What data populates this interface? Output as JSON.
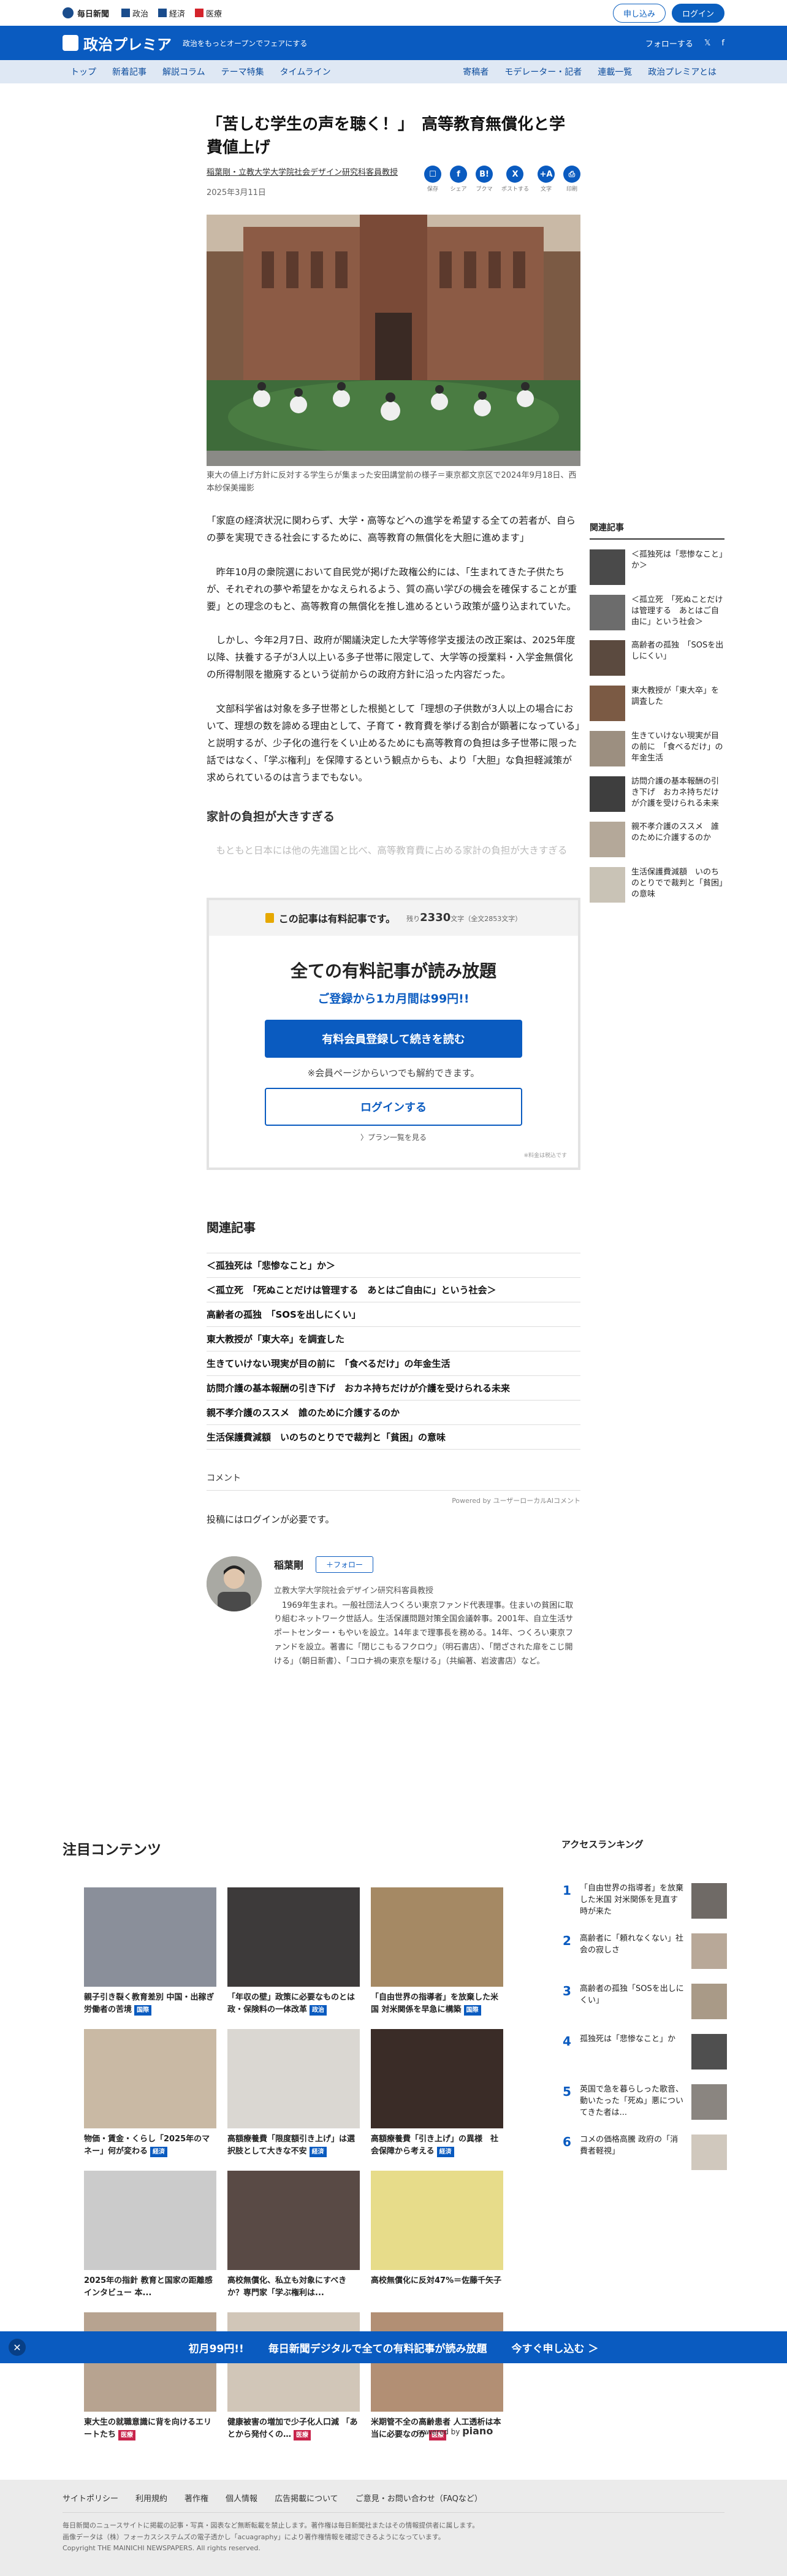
{
  "topbar": {
    "brand": "毎日新聞",
    "sites": [
      "政治",
      "経済",
      "医療"
    ],
    "register": "申し込み",
    "login": "ログイン"
  },
  "header": {
    "logo": "政治プレミア",
    "tagline": "政治をもっとオープンでフェアにする",
    "follow": "フォローする"
  },
  "nav": {
    "left": [
      "トップ",
      "新着記事",
      "解説コラム",
      "テーマ特集",
      "タイムライン"
    ],
    "right": [
      "寄稿者",
      "モデレーター・記者",
      "連載一覧",
      "政治プレミアとは"
    ]
  },
  "article": {
    "title": "「苦しむ学生の声を聴く！」　高等教育無償化と学費値上げ",
    "author_line": "稲葉剛・立教大学大学院社会デザイン研究科客員教授",
    "date": "2025年3月11日",
    "share": [
      {
        "icon": "保存",
        "label": "保存"
      },
      {
        "icon": "f",
        "label": "シェア"
      },
      {
        "icon": "B!",
        "label": "ブクマ"
      },
      {
        "icon": "X",
        "label": "ポストする"
      },
      {
        "icon": "+A",
        "label": "文字"
      },
      {
        "icon": "印",
        "label": "印刷"
      }
    ],
    "caption": "東大の値上げ方針に反対する学生らが集まった安田講堂前の様子＝東京都文京区で2024年9月18日、西本紗保美撮影",
    "paragraphs": [
      "「家庭の経済状況に関わらず、大学・高等などへの進学を希望する全ての若者が、自らの夢を実現できる社会にするために、高等教育の無償化を大胆に進めます」",
      "　昨年10月の衆院選において自民党が掲げた政権公約には、「生まれてきた子供たちが、それぞれの夢や希望をかなえられるよう、質の高い学びの機会を確保することが重要」との理念のもと、高等教育の無償化を推し進めるという政策が盛り込まれていた。",
      "　しかし、今年2月7日、政府が閣議決定した大学等修学支援法の改正案は、2025年度以降、扶養する子が3人以上いる多子世帯に限定して、大学等の授業料・入学金無償化の所得制限を撤廃するという従前からの政府方針に沿った内容だった。",
      "　文部科学省は対象を多子世帯とした根拠として「理想の子供数が3人以上の場合において、理想の数を諦める理由として、子育て・教育費を挙げる割合が顕著になっている」と説明するが、少子化の進行をくい止めるためにも高等教育の負担は多子世帯に限った話ではなく、「学ぶ権利」を保障するという観点からも、より「大胆」な負担軽減策が求められているのは言うまでもない。"
    ],
    "subhead": "家計の負担が大きすぎる",
    "faded": "　もともと日本には他の先進国と比べ、高等教育費に占める家計の負担が大きすぎる"
  },
  "paywall": {
    "notice": "この記事は有料記事です。",
    "remaining_label": "残り",
    "remaining_count": "2330",
    "remaining_unit": "文字（全文2853文字）",
    "title": "全ての有料記事が読み放題",
    "subtitle": "ご登録から1カ月間は99円!!",
    "primary_cta": "有料会員登録して続きを読む",
    "cancel_note": "※会員ページからいつでも解約できます。",
    "login_cta": "ログインする",
    "plans": "〉プラン一覧を見る",
    "version": "※料金は税込です"
  },
  "related": {
    "title": "関連記事",
    "items": [
      "＜孤独死は「悲惨なこと」か＞",
      "＜孤立死　「死ぬことだけは管理する　あとはご自由に」という社会＞",
      "高齢者の孤独　「SOSを出しにくい」",
      "東大教授が「東大卒」を調査した",
      "生きていけない現実が目の前に　「食べるだけ」の年金生活",
      "訪問介護の基本報酬の引き下げ　おカネ持ちだけが介護を受けられる未来",
      "親不孝介護のススメ　誰のために介護するのか",
      "生活保護費減額　いのちのとりでで裁判と「貧困」の意味"
    ]
  },
  "comments": {
    "title": "コメント",
    "powered": "Powered by ユーザーローカルAIコメント",
    "login_note": "投稿にはログインが必要です。"
  },
  "author": {
    "name": "稲葉剛",
    "follow": "＋フォロー",
    "affiliation": "立教大学大学院社会デザイン研究科客員教授",
    "bio": "　1969年生まれ。一般社団法人つくろい東京ファンド代表理事。住まいの貧困に取り組むネットワーク世話人。生活保護問題対策全国会議幹事。2001年、自立生活サポートセンター・もやいを設立。14年まで理事長を務める。14年、つくろい東京ファンドを設立。著書に「閉じこもるフクロウ」（明石書店）、「閉ざされた扉をこじ開ける」（朝日新書）、「コロナ禍の東京を駆ける」（共編著、岩波書店）など。"
  },
  "sidebar": {
    "title": "関連記事",
    "items": [
      "＜孤独死は「悲惨なこと」か＞",
      "＜孤立死　「死ぬことだけは管理する　あとはご自由に」という社会＞",
      "高齢者の孤独　「SOSを出しにくい」",
      "東大教授が「東大卒」を調査した",
      "生きていけない現実が目の前に　「食べるだけ」の年金生活",
      "訪問介護の基本報酬の引き下げ　おカネ持ちだけが介護を受けられる未来",
      "親不孝介護のススメ　誰のために介護するのか",
      "生活保護費減額　いのちのとりでで裁判と「貧困」の意味"
    ]
  },
  "attention": {
    "title": "注目コンテンツ",
    "cards": [
      {
        "title": "親子引き裂く教育差別 中国・出稼ぎ労働者の苦境",
        "tag": "国際",
        "tag_color": "#0a5bc0",
        "color": "#8a8f9a"
      },
      {
        "title": "「年収の壁」政策に必要なものとは 政・保険料の一体改革",
        "tag": "政治",
        "tag_color": "#0a5bc0",
        "color": "#3d3a3a"
      },
      {
        "title": "「自由世界の指導者」を放棄した米国 対米関係を早急に構築",
        "tag": "国際",
        "tag_color": "#0a5bc0",
        "color": "#a58964"
      },
      {
        "title": "物価・賃金・くらし「2025年のマネー」何が変わる",
        "tag": "経済",
        "tag_color": "#0a5bc0",
        "color": "#c9b9a4"
      },
      {
        "title": "高額療養費「限度額引き上げ」は選択肢として大きな不安",
        "tag": "経済",
        "tag_color": "#0a5bc0",
        "color": "#dad7d2"
      },
      {
        "title": "高額療養費「引き上げ」の異様　社会保障から考える",
        "tag": "経済",
        "tag_color": "#0a5bc0",
        "color": "#3a2c27"
      },
      {
        "title": "2025年の指針 教育と国家の距離感 インタビュー 本...",
        "tag": "",
        "tag_color": "#0a5bc0",
        "color": "#cbcbcb"
      },
      {
        "title": "高校無償化、私立も対象にすべきか？専門家「学ぶ権利は...",
        "tag": "",
        "tag_color": "#0a5bc0",
        "color": "#594a45"
      },
      {
        "title": "高校無償化に反対47%＝佐藤千矢子",
        "tag": "",
        "tag_color": "#0a5bc0",
        "color": "#e7dc8a"
      },
      {
        "title": "東大生の就職意識に背を向けるエリートたち",
        "tag": "医療",
        "tag_color": "#c8234a",
        "color": "#b7a390"
      },
      {
        "title": "健康被害の増加で少子化人口減 「あとから発付くの…",
        "tag": "医療",
        "tag_color": "#c8234a",
        "color": "#d1c6b8"
      },
      {
        "title": "米期管不全の高齢患者 人工透析は本当に必要なのか",
        "tag": "医療",
        "tag_color": "#c8234a",
        "color": "#b28f74"
      }
    ]
  },
  "ranking": {
    "title": "アクセスランキング",
    "items": [
      {
        "num": "1",
        "text": "「自由世界の指導者」を放棄した米国 対米関係を見直す時が来た"
      },
      {
        "num": "2",
        "text": "高齢者に「頼れなくない」社会の寂しさ"
      },
      {
        "num": "3",
        "text": "高齢者の孤独「SOSを出しにくい」"
      },
      {
        "num": "4",
        "text": "孤独死は「悲惨なこと」か"
      },
      {
        "num": "5",
        "text": "英国で急を暮らしった歌音、動いたった「死ぬ」悪についてきた者は..."
      },
      {
        "num": "6",
        "text": "コメの価格高騰 政府の「消費者軽視」"
      }
    ],
    "powered": "powered by",
    "piano": "piano"
  },
  "promo": {
    "price": "初月99円!!",
    "message": "毎日新聞デジタルで全ての有料記事が読み放題",
    "cta": "今すぐ申し込む ＞"
  },
  "footer": {
    "links": [
      "サイトポリシー",
      "利用規約",
      "著作権",
      "個人情報",
      "広告掲載について",
      "ご意見・お問い合わせ（FAQなど）"
    ],
    "note1": "毎日新聞のニュースサイトに掲載の記事・写真・図表など無断転載を禁止します。著作権は毎日新聞社またはその情報提供者に属します。",
    "note2": "画像データは（株）フォーカスシステムズの電子透かし「acuagraphy」により著作権情報を確認できるようになっています。",
    "copyright": "Copyright THE MAINICHI NEWSPAPERS. All rights reserved."
  }
}
